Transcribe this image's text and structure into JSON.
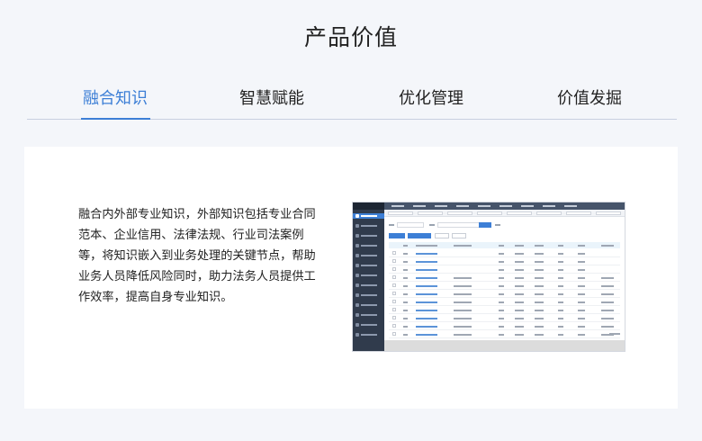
{
  "section": {
    "title": "产品价值"
  },
  "tabs": [
    {
      "label": "融合知识",
      "active": true
    },
    {
      "label": "智慧赋能",
      "active": false
    },
    {
      "label": "优化管理",
      "active": false
    },
    {
      "label": "价值发掘",
      "active": false
    }
  ],
  "content": {
    "description": "融合内外部专业知识，外部知识包括专业合同范本、企业信用、法律法规、行业司法案例等，将知识嵌入到业务处理的关键节点，帮助业务人员降低风险同时，助力法务人员提供工作效率，提高自身专业知识。"
  },
  "colors": {
    "accent": "#3d7fd6",
    "background": "#f4f6fa",
    "card": "#ffffff",
    "mock_sidebar": "#303b4c"
  }
}
